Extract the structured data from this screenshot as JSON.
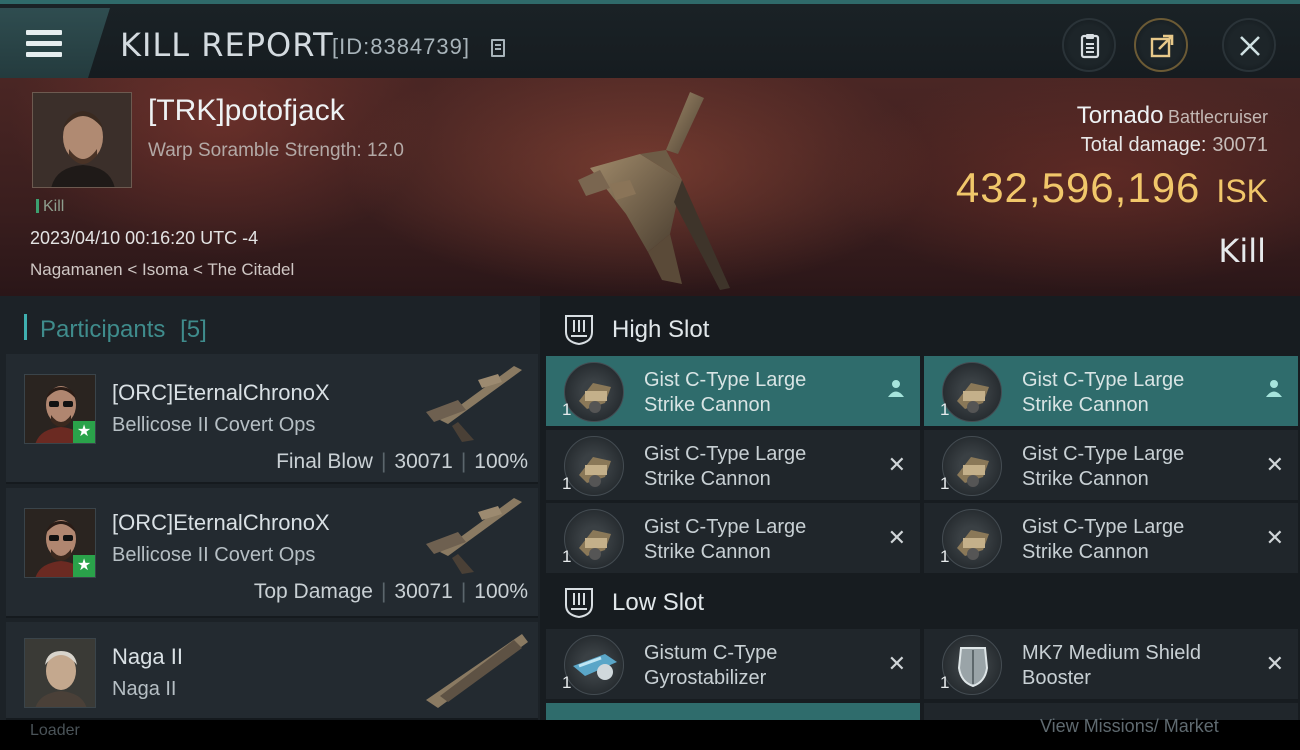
{
  "topbar": {
    "title": "KILL REPORT",
    "id_text": "[ID:8384739]"
  },
  "victim": {
    "name": "[TRK]potofjack",
    "scramble": "Warp Soramble Strength: 12.0",
    "tag": "Kill",
    "date": "2023/04/10 00:16:20 UTC -4",
    "location": "Nagamanen < Isoma < The Citadel",
    "ship_name": "Tornado",
    "ship_class": "Battlecruiser",
    "damage_label": "Total damage:",
    "damage_value": "30071",
    "isk_value": "432,596,196",
    "isk_unit": "ISK",
    "result": "Kill"
  },
  "participants": {
    "label": "Participants",
    "count": "[5]",
    "rows": [
      {
        "name": "[ORC]EternalChronoX",
        "ship": "Bellicose II Covert Ops",
        "role": "Final Blow",
        "damage": "30071",
        "percent": "100%"
      },
      {
        "name": "[ORC]EternalChronoX",
        "ship": "Bellicose II Covert Ops",
        "role": "Top Damage",
        "damage": "30071",
        "percent": "100%"
      },
      {
        "name": "Naga II",
        "ship": "Naga II",
        "role": "",
        "damage": "",
        "percent": ""
      }
    ]
  },
  "slots": {
    "high_title": "High Slot",
    "low_title": "Low Slot",
    "high": [
      {
        "line1": "Gist C-Type Large",
        "line2": "Strike Cannon",
        "qty": "1",
        "mark": "person"
      },
      {
        "line1": "Gist C-Type Large",
        "line2": "Strike Cannon",
        "qty": "1",
        "mark": "person"
      },
      {
        "line1": "Gist C-Type Large",
        "line2": "Strike Cannon",
        "qty": "1",
        "mark": "x"
      },
      {
        "line1": "Gist C-Type Large",
        "line2": "Strike Cannon",
        "qty": "1",
        "mark": "x"
      },
      {
        "line1": "Gist C-Type Large",
        "line2": "Strike Cannon",
        "qty": "1",
        "mark": "x"
      },
      {
        "line1": "Gist C-Type Large",
        "line2": "Strike Cannon",
        "qty": "1",
        "mark": "x"
      }
    ],
    "low": [
      {
        "line1": "Gistum C-Type",
        "line2": "Gyrostabilizer",
        "qty": "1",
        "mark": "x"
      },
      {
        "line1": "MK7 Medium Shield",
        "line2": "Booster",
        "qty": "1",
        "mark": "x"
      }
    ]
  },
  "footer": {
    "hint": "View Missions/ Market",
    "left": "Loader"
  },
  "colors": {
    "accent_teal": "#2f6c6c",
    "isk_gold": "#f1c76a",
    "star_green": "#2aa24a"
  }
}
